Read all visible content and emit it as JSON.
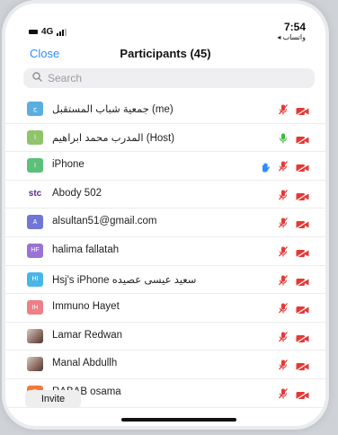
{
  "status": {
    "carrier_network": "4G",
    "time": "7:54",
    "back_app": "◂ واتساب"
  },
  "nav": {
    "close_label": "Close",
    "title": "Participants (45)"
  },
  "search": {
    "placeholder": "Search"
  },
  "participants": [
    {
      "name": "جمعية شباب المستقبل (me)",
      "avatar": "ج",
      "avatar_color": "#5aaee0",
      "mic": "muted-red",
      "camera": "off-red",
      "hand": false
    },
    {
      "name": "المدرب محمد ابراهيم (Host)",
      "avatar": "ا",
      "avatar_color": "#8fc46a",
      "mic": "active-green",
      "camera": "off-red",
      "hand": false
    },
    {
      "name": "iPhone",
      "avatar": "I",
      "avatar_color": "#5cbf7a",
      "mic": "muted-red",
      "camera": "off-red",
      "hand": true
    },
    {
      "name": "Abody 502",
      "avatar": "stc",
      "avatar_color": "#5b2a86",
      "mic": "muted-red",
      "camera": "off-red",
      "hand": false
    },
    {
      "name": "alsultan51@gmail.com",
      "avatar": "A",
      "avatar_color": "#6f76d6",
      "mic": "muted-red",
      "camera": "off-red",
      "hand": false
    },
    {
      "name": "halima fallatah",
      "avatar": "HF",
      "avatar_color": "#9a72d6",
      "mic": "muted-red",
      "camera": "off-red",
      "hand": false
    },
    {
      "name": "Hsj's iPhone سعيد عيسى عصيده",
      "avatar": "HI",
      "avatar_color": "#49b6e8",
      "mic": "muted-red",
      "camera": "off-red",
      "hand": false
    },
    {
      "name": "Immuno Hayet",
      "avatar": "IH",
      "avatar_color": "#ee7f86",
      "mic": "muted-red",
      "camera": "off-red",
      "hand": false
    },
    {
      "name": "Lamar Redwan",
      "avatar": "",
      "avatar_color": "photo",
      "mic": "muted-red",
      "camera": "off-red",
      "hand": false
    },
    {
      "name": "Manal Abdullh",
      "avatar": "",
      "avatar_color": "photo",
      "mic": "muted-red",
      "camera": "off-red",
      "hand": false
    },
    {
      "name": "RABAB osama",
      "avatar": "R",
      "avatar_color": "#f07a3a",
      "mic": "muted-red",
      "camera": "off-red",
      "hand": false
    }
  ],
  "footer": {
    "invite_label": "Invite"
  }
}
